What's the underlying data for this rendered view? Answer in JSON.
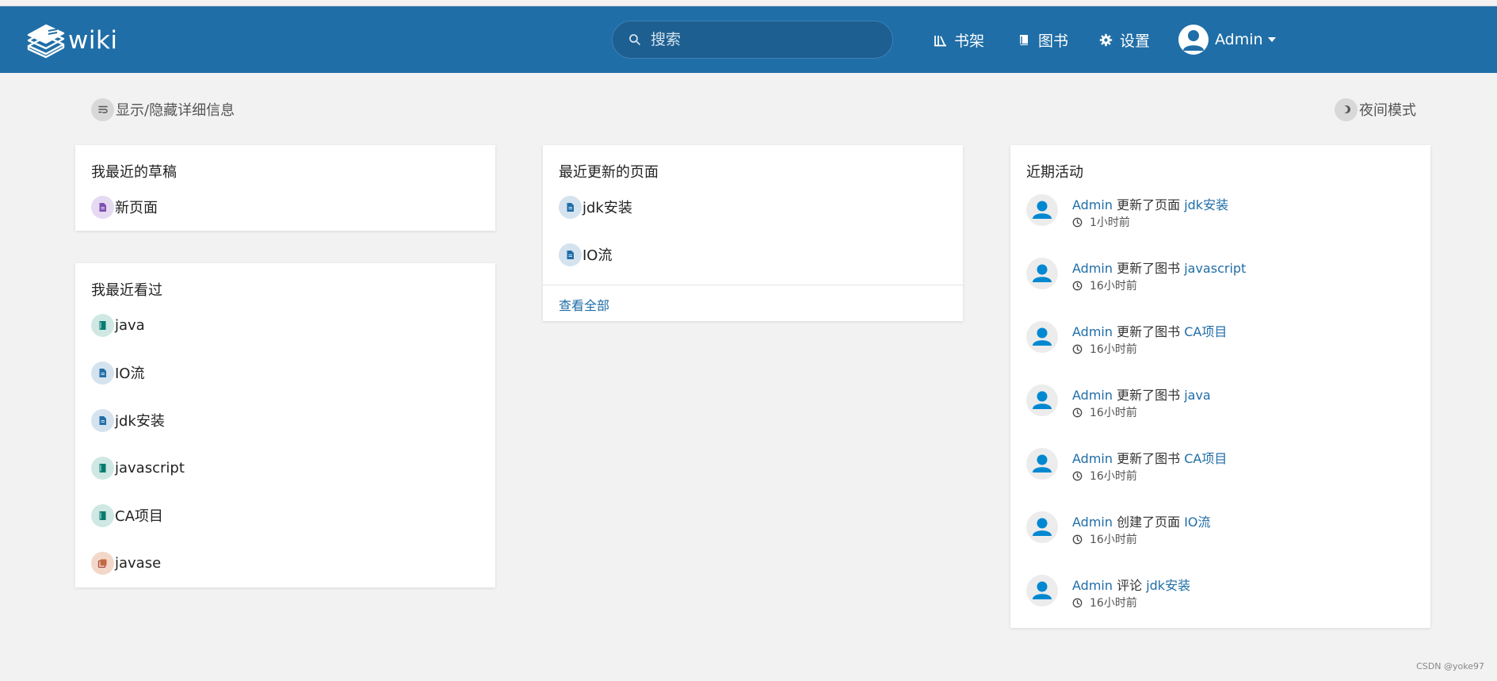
{
  "app": {
    "logo_text": "wiki"
  },
  "header": {
    "search_placeholder": "搜索",
    "nav": {
      "shelves": "书架",
      "books": "图书",
      "settings": "设置"
    },
    "user_name": "Admin"
  },
  "toggles": {
    "details": "显示/隐藏详细信息",
    "night": "夜间模式"
  },
  "drafts": {
    "title": "我最近的草稿",
    "items": [
      {
        "label": "新页面",
        "type": "draft"
      }
    ]
  },
  "viewed": {
    "title": "我最近看过",
    "items": [
      {
        "label": "java",
        "type": "book"
      },
      {
        "label": "IO流",
        "type": "page"
      },
      {
        "label": "jdk安装",
        "type": "page"
      },
      {
        "label": "javascript",
        "type": "book"
      },
      {
        "label": "CA项目",
        "type": "book"
      },
      {
        "label": "javase",
        "type": "shelf"
      }
    ]
  },
  "updated": {
    "title": "最近更新的页面",
    "items": [
      {
        "label": "jdk安装",
        "type": "page"
      },
      {
        "label": "IO流",
        "type": "page"
      }
    ],
    "view_all": "查看全部"
  },
  "activity": {
    "title": "近期活动",
    "items": [
      {
        "user": "Admin",
        "action": "更新了页面",
        "target": "jdk安装",
        "time": "1小时前"
      },
      {
        "user": "Admin",
        "action": "更新了图书",
        "target": "javascript",
        "time": "16小时前"
      },
      {
        "user": "Admin",
        "action": "更新了图书",
        "target": "CA项目",
        "time": "16小时前"
      },
      {
        "user": "Admin",
        "action": "更新了图书",
        "target": "java",
        "time": "16小时前"
      },
      {
        "user": "Admin",
        "action": "更新了图书",
        "target": "CA项目",
        "time": "16小时前"
      },
      {
        "user": "Admin",
        "action": "创建了页面",
        "target": "IO流",
        "time": "16小时前"
      },
      {
        "user": "Admin",
        "action": "评论",
        "target": "jdk安装",
        "time": "16小时前"
      }
    ]
  },
  "watermark": "CSDN @yoke97",
  "colors": {
    "header_bg": "#206ea7",
    "link": "#206ea7",
    "page_icon": "#206ea7",
    "draft_icon": "#7e50b1",
    "book_icon": "#077b70",
    "shelf_icon": "#a94747",
    "avatar_person": "#0288d1"
  }
}
